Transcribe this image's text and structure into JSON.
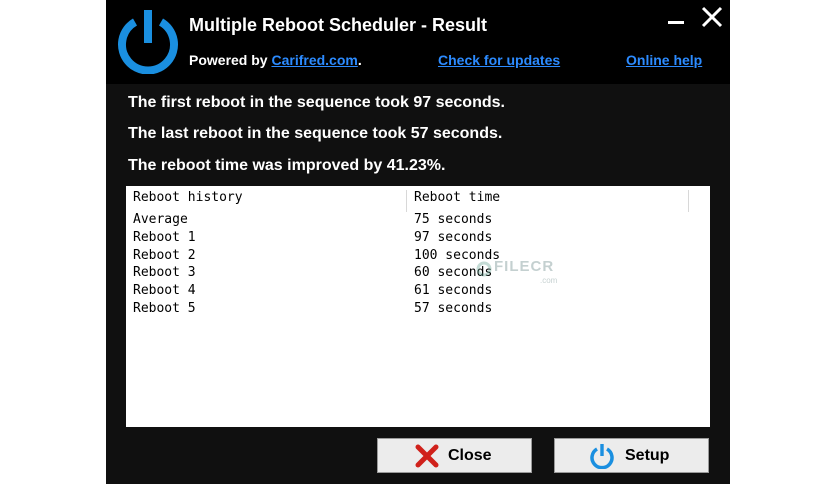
{
  "window": {
    "title": "Multiple Reboot Scheduler - Result",
    "powered_prefix": "Powered by ",
    "powered_link": "Carifred.com",
    "powered_suffix": ".",
    "check_updates": "Check for updates",
    "online_help": "Online help"
  },
  "messages": [
    "The first reboot in the sequence took 97 seconds.",
    "The last reboot in the sequence took 57 seconds.",
    "The reboot time was improved by 41.23%."
  ],
  "table": {
    "headers": [
      "Reboot history",
      "Reboot time"
    ],
    "rows": [
      [
        "Average",
        "75 seconds"
      ],
      [
        "Reboot 1",
        "97 seconds"
      ],
      [
        "Reboot 2",
        "100 seconds"
      ],
      [
        "Reboot 3",
        "60 seconds"
      ],
      [
        "Reboot 4",
        "61 seconds"
      ],
      [
        "Reboot 5",
        "57 seconds"
      ]
    ]
  },
  "watermark": {
    "text": "FILECR",
    "suffix": ".com"
  },
  "buttons": {
    "close": "Close",
    "setup": "Setup"
  },
  "icons": {
    "logo": "power-icon",
    "close_button": "red-x-icon",
    "setup_button": "power-icon"
  },
  "colors": {
    "link": "#2c8bff",
    "logo_blue": "#1a8fe0",
    "close_red": "#d0211b"
  }
}
